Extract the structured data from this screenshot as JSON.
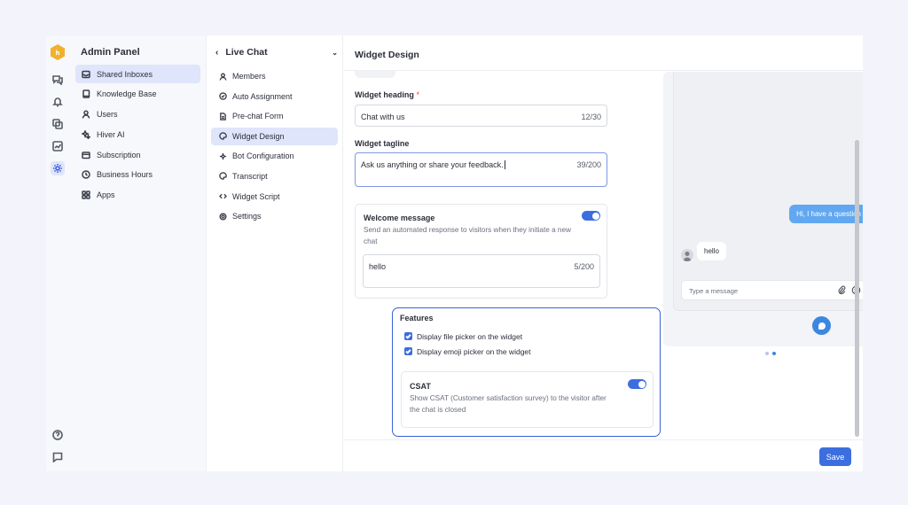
{
  "admin": {
    "title": "Admin Panel",
    "items": [
      {
        "label": "Shared Inboxes",
        "icon": "inbox-icon",
        "active": true
      },
      {
        "label": "Knowledge Base",
        "icon": "book-icon"
      },
      {
        "label": "Users",
        "icon": "user-icon"
      },
      {
        "label": "Hiver AI",
        "icon": "sparkle-icon"
      },
      {
        "label": "Subscription",
        "icon": "card-icon"
      },
      {
        "label": "Business Hours",
        "icon": "clock-icon"
      },
      {
        "label": "Apps",
        "icon": "grid-icon"
      }
    ]
  },
  "livechat": {
    "title": "Live Chat",
    "items": [
      {
        "label": "Members",
        "icon": "user-icon"
      },
      {
        "label": "Auto Assignment",
        "icon": "check-circle-icon"
      },
      {
        "label": "Pre-chat Form",
        "icon": "document-icon"
      },
      {
        "label": "Widget Design",
        "icon": "palette-icon",
        "active": true
      },
      {
        "label": "Bot Configuration",
        "icon": "bot-icon"
      },
      {
        "label": "Transcript",
        "icon": "palette-icon"
      },
      {
        "label": "Widget Script",
        "icon": "code-icon"
      },
      {
        "label": "Settings",
        "icon": "gear-icon"
      }
    ]
  },
  "page": {
    "title": "Widget Design",
    "save_label": "Save"
  },
  "form": {
    "heading_label": "Widget heading",
    "heading_required": "*",
    "heading_value": "Chat with us",
    "heading_count": "12/30",
    "tagline_label": "Widget tagline",
    "tagline_value": "Ask us anything or share your feedback.",
    "tagline_count": "39/200",
    "welcome": {
      "title": "Welcome message",
      "desc": "Send an automated response to visitors when they initiate a new chat",
      "value": "hello",
      "count": "5/200",
      "enabled": true
    },
    "features": {
      "title": "Features",
      "file_picker": "Display file picker on the widget",
      "emoji_picker": "Display emoji picker on the widget",
      "csat_title": "CSAT",
      "csat_desc": "Show CSAT (Customer satisfaction survey) to the visitor after the chat is closed",
      "csat_enabled": true
    }
  },
  "preview": {
    "outgoing": "Hi, I have a question",
    "incoming": "hello",
    "placeholder": "Type a message"
  },
  "colors": {
    "accent": "#3c6ee0",
    "highlight": "#3a62d6",
    "chat_bubble": "#61a8f0"
  }
}
